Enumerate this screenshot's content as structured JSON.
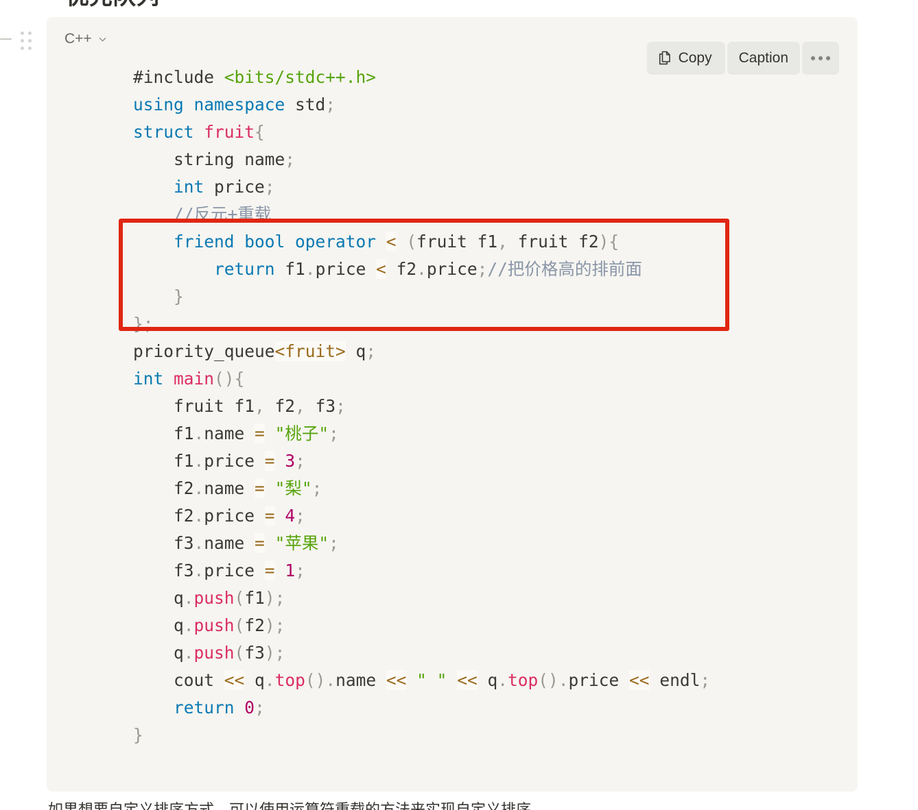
{
  "page": {
    "heading_fragment": "优先队列",
    "below_paragraph": "如果想要自定义排序方式，可以使用运算符重载的方法来实现自定义排序。"
  },
  "gutter": {
    "collapse_icon": "collapse-dash-icon",
    "drag_icon": "drag-handle-icon"
  },
  "codeblock": {
    "language": "C++",
    "language_chevron_icon": "chevron-down-icon",
    "actions": {
      "copy_label": "Copy",
      "copy_icon": "copy-pages-icon",
      "caption_label": "Caption",
      "more_label": "",
      "more_icon": "ellipsis-icon"
    },
    "colors": {
      "background": "#f6f5f1",
      "keyword": "#0b79b3",
      "type": "#db2d63",
      "string": "#58a40d",
      "number": "#b00064",
      "comment": "#8a96a8",
      "punctuation": "#9a9993",
      "operator": "#9b6b1e",
      "plain": "#3b3a36",
      "button_bg": "#e8e8e4",
      "annotation_red": "#e02612"
    },
    "lines": [
      [
        {
          "t": "#include",
          "c": "pre"
        },
        {
          "t": " ",
          "c": "plain"
        },
        {
          "t": "<bits/stdc++.h>",
          "c": "str"
        }
      ],
      [
        {
          "t": "using namespace",
          "c": "kw"
        },
        {
          "t": " std",
          "c": "plain"
        },
        {
          "t": ";",
          "c": "pun"
        }
      ],
      [
        {
          "t": "struct",
          "c": "kw"
        },
        {
          "t": " ",
          "c": "plain"
        },
        {
          "t": "fruit",
          "c": "type"
        },
        {
          "t": "{",
          "c": "pun"
        }
      ],
      [
        {
          "t": "    string name",
          "c": "plain"
        },
        {
          "t": ";",
          "c": "pun"
        }
      ],
      [
        {
          "t": "    ",
          "c": "plain"
        },
        {
          "t": "int",
          "c": "kw"
        },
        {
          "t": " price",
          "c": "plain"
        },
        {
          "t": ";",
          "c": "pun"
        }
      ],
      [
        {
          "t": "    ",
          "c": "plain"
        },
        {
          "t": "//反元+重载",
          "c": "com"
        }
      ],
      [
        {
          "t": "    ",
          "c": "plain"
        },
        {
          "t": "friend bool operator",
          "c": "kw"
        },
        {
          "t": " ",
          "c": "plain"
        },
        {
          "t": "<",
          "c": "op"
        },
        {
          "t": " ",
          "c": "plain"
        },
        {
          "t": "(",
          "c": "pun"
        },
        {
          "t": "fruit f1",
          "c": "plain"
        },
        {
          "t": ",",
          "c": "pun"
        },
        {
          "t": " fruit f2",
          "c": "plain"
        },
        {
          "t": ")",
          "c": "pun"
        },
        {
          "t": "{",
          "c": "pun"
        }
      ],
      [
        {
          "t": "        ",
          "c": "plain"
        },
        {
          "t": "return",
          "c": "kw"
        },
        {
          "t": " f1",
          "c": "plain"
        },
        {
          "t": ".",
          "c": "pun"
        },
        {
          "t": "price ",
          "c": "plain"
        },
        {
          "t": "<",
          "c": "op"
        },
        {
          "t": " f2",
          "c": "plain"
        },
        {
          "t": ".",
          "c": "pun"
        },
        {
          "t": "price",
          "c": "plain"
        },
        {
          "t": ";",
          "c": "pun"
        },
        {
          "t": "//把价格高的排前面",
          "c": "com"
        }
      ],
      [
        {
          "t": "    ",
          "c": "plain"
        },
        {
          "t": "}",
          "c": "pun"
        }
      ],
      [
        {
          "t": "}",
          "c": "pun"
        },
        {
          "t": ";",
          "c": "pun"
        }
      ],
      [
        {
          "t": "priority_queue",
          "c": "plain"
        },
        {
          "t": "<fruit>",
          "c": "op"
        },
        {
          "t": " q",
          "c": "plain"
        },
        {
          "t": ";",
          "c": "pun"
        }
      ],
      [
        {
          "t": "int",
          "c": "kw"
        },
        {
          "t": " ",
          "c": "plain"
        },
        {
          "t": "main",
          "c": "type"
        },
        {
          "t": "()",
          "c": "pun"
        },
        {
          "t": "{",
          "c": "pun"
        }
      ],
      [
        {
          "t": "    fruit f1",
          "c": "plain"
        },
        {
          "t": ",",
          "c": "pun"
        },
        {
          "t": " f2",
          "c": "plain"
        },
        {
          "t": ",",
          "c": "pun"
        },
        {
          "t": " f3",
          "c": "plain"
        },
        {
          "t": ";",
          "c": "pun"
        }
      ],
      [
        {
          "t": "    f1",
          "c": "plain"
        },
        {
          "t": ".",
          "c": "pun"
        },
        {
          "t": "name ",
          "c": "plain"
        },
        {
          "t": "=",
          "c": "op"
        },
        {
          "t": " ",
          "c": "plain"
        },
        {
          "t": "\"桃子\"",
          "c": "str"
        },
        {
          "t": ";",
          "c": "pun"
        }
      ],
      [
        {
          "t": "    f1",
          "c": "plain"
        },
        {
          "t": ".",
          "c": "pun"
        },
        {
          "t": "price ",
          "c": "plain"
        },
        {
          "t": "=",
          "c": "op"
        },
        {
          "t": " ",
          "c": "plain"
        },
        {
          "t": "3",
          "c": "num"
        },
        {
          "t": ";",
          "c": "pun"
        }
      ],
      [
        {
          "t": "    f2",
          "c": "plain"
        },
        {
          "t": ".",
          "c": "pun"
        },
        {
          "t": "name ",
          "c": "plain"
        },
        {
          "t": "=",
          "c": "op"
        },
        {
          "t": " ",
          "c": "plain"
        },
        {
          "t": "\"梨\"",
          "c": "str"
        },
        {
          "t": ";",
          "c": "pun"
        }
      ],
      [
        {
          "t": "    f2",
          "c": "plain"
        },
        {
          "t": ".",
          "c": "pun"
        },
        {
          "t": "price ",
          "c": "plain"
        },
        {
          "t": "=",
          "c": "op"
        },
        {
          "t": " ",
          "c": "plain"
        },
        {
          "t": "4",
          "c": "num"
        },
        {
          "t": ";",
          "c": "pun"
        }
      ],
      [
        {
          "t": "    f3",
          "c": "plain"
        },
        {
          "t": ".",
          "c": "pun"
        },
        {
          "t": "name ",
          "c": "plain"
        },
        {
          "t": "=",
          "c": "op"
        },
        {
          "t": " ",
          "c": "plain"
        },
        {
          "t": "\"苹果\"",
          "c": "str"
        },
        {
          "t": ";",
          "c": "pun"
        }
      ],
      [
        {
          "t": "    f3",
          "c": "plain"
        },
        {
          "t": ".",
          "c": "pun"
        },
        {
          "t": "price ",
          "c": "plain"
        },
        {
          "t": "=",
          "c": "op"
        },
        {
          "t": " ",
          "c": "plain"
        },
        {
          "t": "1",
          "c": "num"
        },
        {
          "t": ";",
          "c": "pun"
        }
      ],
      [
        {
          "t": "    q",
          "c": "plain"
        },
        {
          "t": ".",
          "c": "pun"
        },
        {
          "t": "push",
          "c": "type"
        },
        {
          "t": "(",
          "c": "pun"
        },
        {
          "t": "f1",
          "c": "plain"
        },
        {
          "t": ")",
          "c": "pun"
        },
        {
          "t": ";",
          "c": "pun"
        }
      ],
      [
        {
          "t": "    q",
          "c": "plain"
        },
        {
          "t": ".",
          "c": "pun"
        },
        {
          "t": "push",
          "c": "type"
        },
        {
          "t": "(",
          "c": "pun"
        },
        {
          "t": "f2",
          "c": "plain"
        },
        {
          "t": ")",
          "c": "pun"
        },
        {
          "t": ";",
          "c": "pun"
        }
      ],
      [
        {
          "t": "    q",
          "c": "plain"
        },
        {
          "t": ".",
          "c": "pun"
        },
        {
          "t": "push",
          "c": "type"
        },
        {
          "t": "(",
          "c": "pun"
        },
        {
          "t": "f3",
          "c": "plain"
        },
        {
          "t": ")",
          "c": "pun"
        },
        {
          "t": ";",
          "c": "pun"
        }
      ],
      [
        {
          "t": "    cout ",
          "c": "plain"
        },
        {
          "t": "<<",
          "c": "op"
        },
        {
          "t": " q",
          "c": "plain"
        },
        {
          "t": ".",
          "c": "pun"
        },
        {
          "t": "top",
          "c": "type"
        },
        {
          "t": "()",
          "c": "pun"
        },
        {
          "t": ".",
          "c": "pun"
        },
        {
          "t": "name ",
          "c": "plain"
        },
        {
          "t": "<<",
          "c": "op"
        },
        {
          "t": " ",
          "c": "plain"
        },
        {
          "t": "\" \"",
          "c": "str"
        },
        {
          "t": " ",
          "c": "plain"
        },
        {
          "t": "<<",
          "c": "op"
        },
        {
          "t": " q",
          "c": "plain"
        },
        {
          "t": ".",
          "c": "pun"
        },
        {
          "t": "top",
          "c": "type"
        },
        {
          "t": "()",
          "c": "pun"
        },
        {
          "t": ".",
          "c": "pun"
        },
        {
          "t": "price ",
          "c": "plain"
        },
        {
          "t": "<<",
          "c": "op"
        },
        {
          "t": " endl",
          "c": "plain"
        },
        {
          "t": ";",
          "c": "pun"
        }
      ],
      [
        {
          "t": "    ",
          "c": "plain"
        },
        {
          "t": "return",
          "c": "kw"
        },
        {
          "t": " ",
          "c": "plain"
        },
        {
          "t": "0",
          "c": "num"
        },
        {
          "t": ";",
          "c": "pun"
        }
      ],
      [
        {
          "t": "}",
          "c": "pun"
        }
      ]
    ]
  },
  "annotation": {
    "type": "red-rectangle-highlight",
    "covers_lines": [
      6,
      7,
      8,
      9
    ],
    "color": "#e02612"
  }
}
